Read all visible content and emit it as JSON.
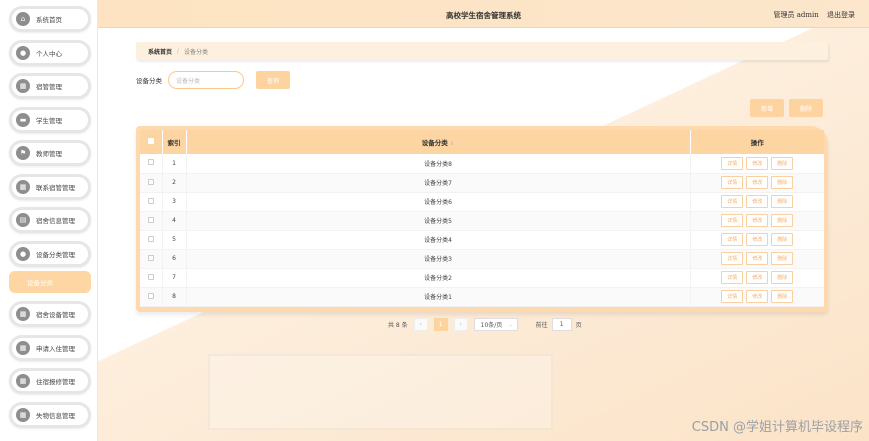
{
  "app": {
    "title": "高校学生宿舍管理系统",
    "user": "管理员 admin",
    "logout": "退出登录"
  },
  "sidebar": {
    "items": [
      {
        "label": "系统首页",
        "icon": "home-icon"
      },
      {
        "label": "个人中心",
        "icon": "user-icon"
      },
      {
        "label": "宿管管理",
        "icon": "grid-icon"
      },
      {
        "label": "学生管理",
        "icon": "student-icon"
      },
      {
        "label": "教师管理",
        "icon": "flag-icon"
      },
      {
        "label": "联系宿管管理",
        "icon": "grid-icon"
      },
      {
        "label": "宿舍信息管理",
        "icon": "doc-icon"
      },
      {
        "label": "设备分类管理",
        "icon": "pin-icon"
      }
    ],
    "sub_item": "设备分类",
    "items_after": [
      {
        "label": "宿舍设备管理",
        "icon": "grid-icon"
      },
      {
        "label": "申请入住管理",
        "icon": "grid-icon"
      },
      {
        "label": "住宿报修管理",
        "icon": "grid-icon"
      },
      {
        "label": "失物信息管理",
        "icon": "grid-icon"
      }
    ]
  },
  "breadcrumb": {
    "home": "系统首页",
    "separator": "/",
    "current": "设备分类"
  },
  "search": {
    "label": "设备分类",
    "placeholder": "设备分类",
    "button": "查询"
  },
  "actions": {
    "add": "新增",
    "delete": "删除"
  },
  "table": {
    "headers": {
      "index": "索引",
      "category": "设备分类",
      "ops": "操作"
    },
    "rows": [
      {
        "index": "1",
        "category": "设备分类8"
      },
      {
        "index": "2",
        "category": "设备分类7"
      },
      {
        "index": "3",
        "category": "设备分类6"
      },
      {
        "index": "4",
        "category": "设备分类5"
      },
      {
        "index": "5",
        "category": "设备分类4"
      },
      {
        "index": "6",
        "category": "设备分类3"
      },
      {
        "index": "7",
        "category": "设备分类2"
      },
      {
        "index": "8",
        "category": "设备分类1"
      }
    ],
    "row_actions": {
      "detail": "详情",
      "edit": "修改",
      "delete": "删除"
    }
  },
  "pagination": {
    "total": "共 8 条",
    "prev": "‹",
    "page": "1",
    "next": "›",
    "page_size": "10条/页",
    "goto_label": "前往",
    "goto_value": "1",
    "goto_suffix": "页"
  },
  "watermark": "CSDN @学姐计算机毕设程序",
  "colors": {
    "accent": "#fdd4a0",
    "accent_text": "#f5b06a"
  }
}
